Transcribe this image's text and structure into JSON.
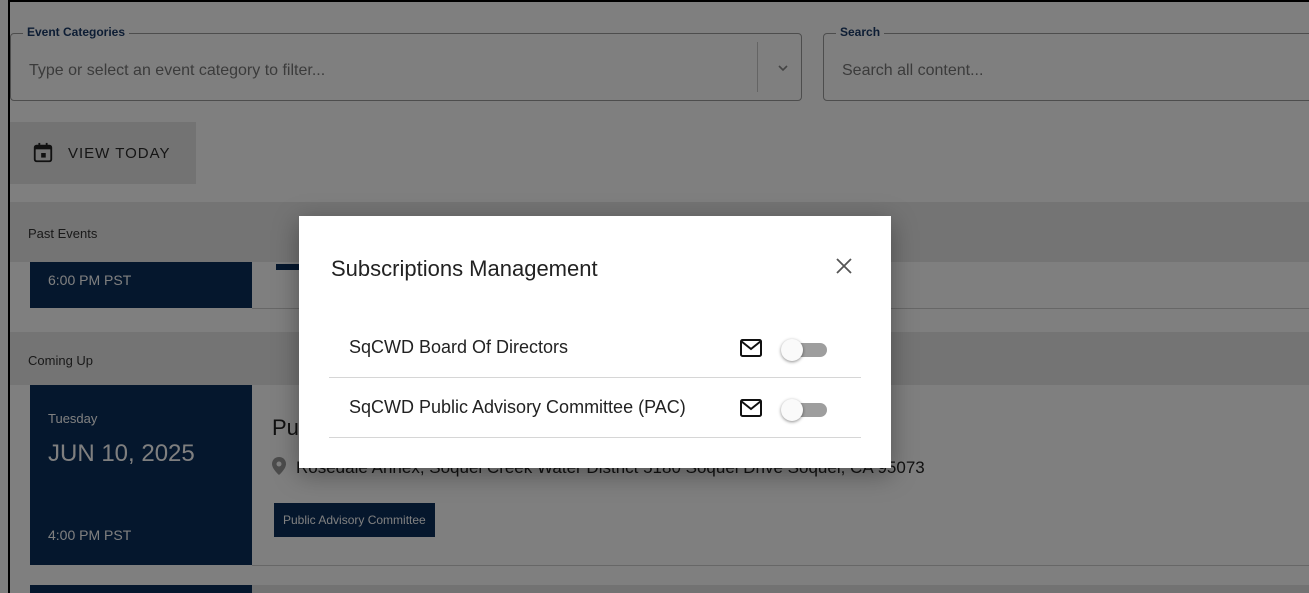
{
  "filters": {
    "category_label": "Event Categories",
    "category_placeholder": "Type or select an event category to filter...",
    "search_label": "Search",
    "search_placeholder": "Search all content..."
  },
  "toolbar": {
    "view_today_label": "VIEW TODAY"
  },
  "sections": {
    "past_label": "Past Events",
    "coming_label": "Coming Up"
  },
  "past_event": {
    "time": "6:00 PM PST"
  },
  "upcoming_event": {
    "day": "Tuesday",
    "date": "JUN 10, 2025",
    "time": "4:00 PM PST",
    "title": "Pu",
    "location": "Rosedale Annex, Soquel Creek Water District 5180 Soquel Drive Soquel, CA 95073",
    "tag": "Public Advisory Committee"
  },
  "modal": {
    "title": "Subscriptions Management",
    "subscriptions": [
      {
        "label": "SqCWD Board Of Directors",
        "enabled": false
      },
      {
        "label": "SqCWD Public Advisory Committee (PAC)",
        "enabled": false
      }
    ]
  },
  "colors": {
    "brand_navy": "#0b2f5b",
    "overlay": "rgba(0,0,0,0.5)"
  }
}
